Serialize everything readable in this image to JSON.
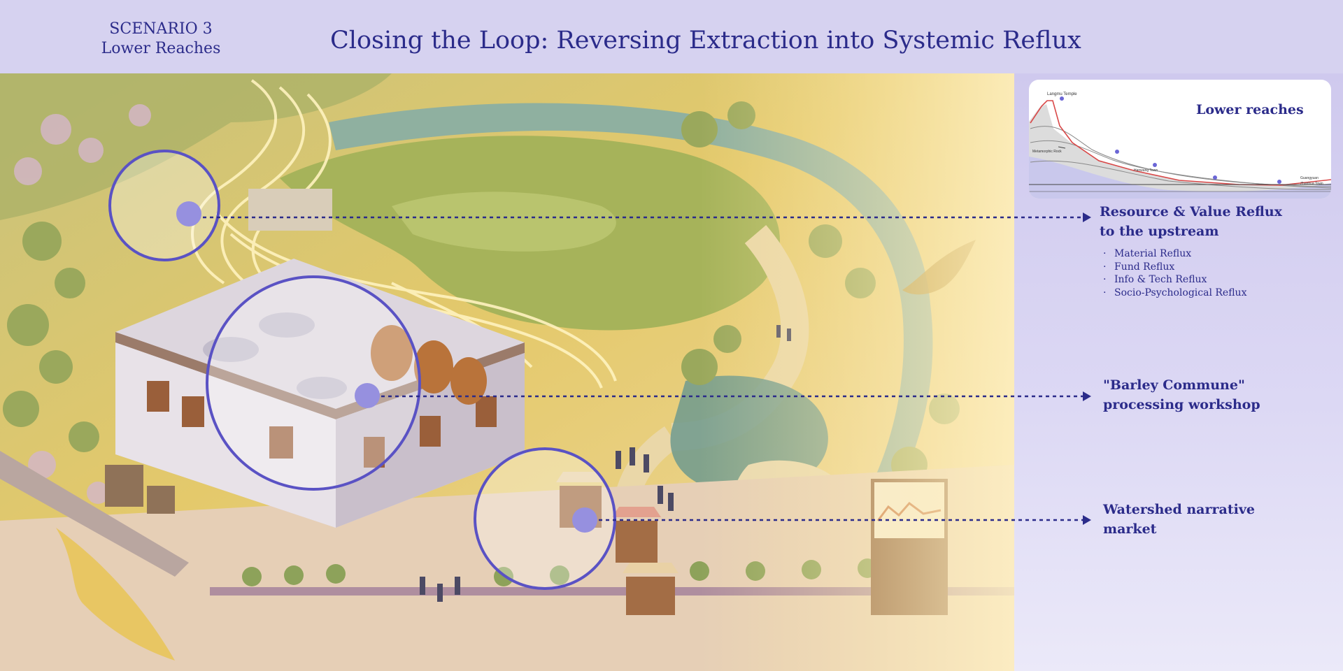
{
  "header": {
    "scenario_line1": "SCENARIO 3",
    "scenario_line2": "Lower Reaches",
    "title": "Closing the Loop: Reversing Extraction into Systemic Reflux"
  },
  "inset": {
    "label": "Lower reaches",
    "profile_labels": [
      "Langmu Temple",
      "Metamorphic Rock",
      "Hanwang Town",
      "Guangyuan",
      "Zhanhua Town"
    ]
  },
  "annotations": [
    {
      "title_line1": "Resource & Value Reflux",
      "title_line2": "to the upstream",
      "items": [
        "Material Reflux",
        "Fund Reflux",
        "Info & Tech Reflux",
        "Socio-Psychological Reflux"
      ]
    },
    {
      "title_line1": "\"Barley Commune\"",
      "title_line2": "processing workshop"
    },
    {
      "title_line1": "Watershed narrative",
      "title_line2": "market"
    }
  ],
  "colors": {
    "accent": "#2b2b8a",
    "header_bg": "#d6d2f0",
    "marker": "#9690df",
    "circle_stroke": "#5a52c4"
  }
}
